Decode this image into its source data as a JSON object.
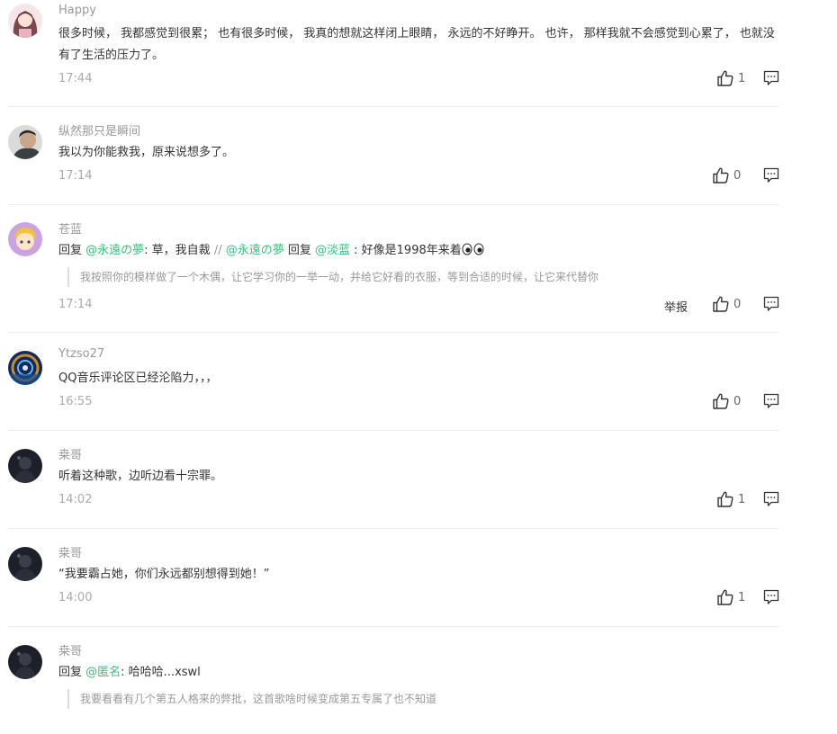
{
  "comments": [
    {
      "username": "Happy",
      "avatar": "girl-avatar",
      "content": [
        {
          "type": "text",
          "text": "很多时候， 我都感觉到很累； 也有很多时候， 我真的想就这样闭上眼睛， 永远的不好睁开。 也许， 那样我就不会感觉到心累了， 也就没有了生活的压力了。"
        }
      ],
      "time": "17:44",
      "likes": "1"
    },
    {
      "username": "纵然那只是瞬间",
      "avatar": "man-avatar",
      "content": [
        {
          "type": "text",
          "text": "我以为你能救我，原来说想多了。"
        }
      ],
      "time": "17:14",
      "likes": "0"
    },
    {
      "username": "苍蓝",
      "avatar": "anime-avatar",
      "content": [
        {
          "type": "text",
          "text": "回复 "
        },
        {
          "type": "mention",
          "text": "@永遠の夢"
        },
        {
          "type": "text",
          "text": ": 草，我自裁 "
        },
        {
          "type": "sep",
          "text": "//"
        },
        {
          "type": "text",
          "text": " "
        },
        {
          "type": "mention",
          "text": "@永遠の夢"
        },
        {
          "type": "text",
          "text": " 回复 "
        },
        {
          "type": "mention",
          "text": "@淡蓝"
        },
        {
          "type": "text",
          "text": " : 好像是1998年来着"
        },
        {
          "type": "emoji",
          "text": "eyes-emoji"
        }
      ],
      "quote": "我按照你的模样做了一个木偶，让它学习你的一举一动，并给它好看的衣服，等到合适的时候，让它来代替你",
      "time": "17:14",
      "report": "举报",
      "likes": "0"
    },
    {
      "username": "Ytzso27",
      "avatar": "pattern-avatar",
      "content": [
        {
          "type": "text",
          "text": "QQ音乐评论区已经沦陷力，，，"
        }
      ],
      "time": "16:55",
      "likes": "0"
    },
    {
      "username": "桒哥",
      "avatar": "dark-avatar",
      "content": [
        {
          "type": "text",
          "text": "听着这种歌，边听边看十宗罪。"
        }
      ],
      "time": "14:02",
      "likes": "1"
    },
    {
      "username": "桒哥",
      "avatar": "dark-avatar",
      "content": [
        {
          "type": "text",
          "text": "“我要霸占她，你们永远都别想得到她！”"
        }
      ],
      "time": "14:00",
      "likes": "1"
    },
    {
      "username": "桒哥",
      "avatar": "dark-avatar",
      "content": [
        {
          "type": "text",
          "text": "回复 "
        },
        {
          "type": "mention",
          "text": "@匿名"
        },
        {
          "type": "text",
          "text": ": 哈哈哈...xswl"
        }
      ],
      "quote": "我要看看有几个第五人格来的弊批，这首歌啥时候变成第五专属了也不知道",
      "likes": ""
    }
  ],
  "colors": {
    "mention": "#31c27c",
    "username": "#999999",
    "time": "#aaaaaa",
    "divider": "#eeeeee"
  }
}
